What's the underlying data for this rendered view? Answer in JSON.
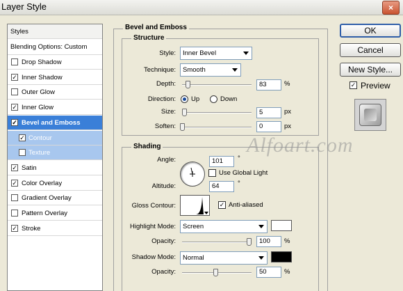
{
  "window": {
    "title": "Layer Style",
    "close_label": "×"
  },
  "styles_panel": {
    "header": "Styles",
    "blending": "Blending Options: Custom",
    "items": [
      {
        "label": "Drop Shadow",
        "checked": false
      },
      {
        "label": "Inner Shadow",
        "checked": true
      },
      {
        "label": "Outer Glow",
        "checked": false
      },
      {
        "label": "Inner Glow",
        "checked": true
      },
      {
        "label": "Bevel and Emboss",
        "checked": true
      },
      {
        "label": "Contour",
        "checked": true
      },
      {
        "label": "Texture",
        "checked": false
      },
      {
        "label": "Satin",
        "checked": true
      },
      {
        "label": "Color Overlay",
        "checked": true
      },
      {
        "label": "Gradient Overlay",
        "checked": false
      },
      {
        "label": "Pattern Overlay",
        "checked": false
      },
      {
        "label": "Stroke",
        "checked": true
      }
    ]
  },
  "bevel": {
    "section_title": "Bevel and Emboss",
    "structure": {
      "title": "Structure",
      "style_label": "Style:",
      "style_value": "Inner Bevel",
      "technique_label": "Technique:",
      "technique_value": "Smooth",
      "depth_label": "Depth:",
      "depth_value": "83",
      "depth_unit": "%",
      "depth_level": 0.08,
      "direction_label": "Direction:",
      "dir_up": "Up",
      "dir_down": "Down",
      "direction_selected": "Up",
      "size_label": "Size:",
      "size_value": "5",
      "size_unit": "px",
      "size_level": 0.03,
      "soften_label": "Soften:",
      "soften_value": "0",
      "soften_unit": "px",
      "soften_level": 0
    },
    "shading": {
      "title": "Shading",
      "angle_label": "Angle:",
      "angle_value": "101",
      "angle_unit": "°",
      "global_light_label": "Use Global Light",
      "global_light_checked": false,
      "altitude_label": "Altitude:",
      "altitude_value": "64",
      "altitude_unit": "°",
      "gloss_label": "Gloss Contour:",
      "anti_aliased_label": "Anti-aliased",
      "anti_aliased_checked": true,
      "highlight_mode_label": "Highlight Mode:",
      "highlight_mode_value": "Screen",
      "highlight_color": "#ffffff",
      "highlight_opacity_label": "Opacity:",
      "highlight_opacity_value": "100",
      "highlight_opacity_unit": "%",
      "highlight_opacity_level": 1.0,
      "shadow_mode_label": "Shadow Mode:",
      "shadow_mode_value": "Normal",
      "shadow_color": "#000000",
      "shadow_opacity_label": "Opacity:",
      "shadow_opacity_value": "50",
      "shadow_opacity_unit": "%",
      "shadow_opacity_level": 0.5
    }
  },
  "buttons": {
    "ok": "OK",
    "cancel": "Cancel",
    "new_style": "New Style...",
    "preview": "Preview",
    "preview_checked": true
  },
  "watermark": "Alfoart.com",
  "colors": {
    "selection": "#3a7fd8",
    "sub_selection": "#a8c7ee"
  }
}
